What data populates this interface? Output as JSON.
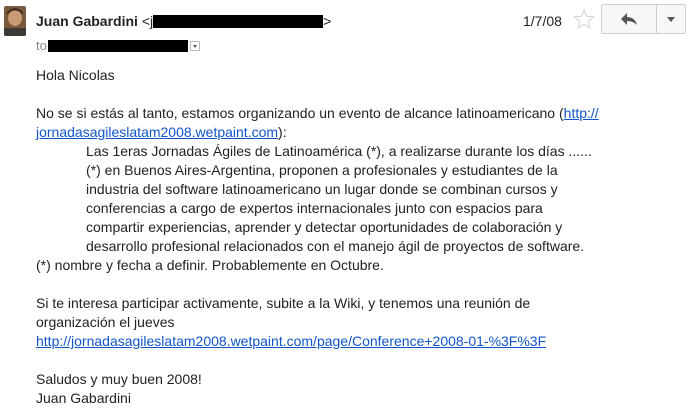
{
  "header": {
    "sender_name": "Juan Gabardini",
    "sender_email_prefix": "<j",
    "sender_email_suffix": ">",
    "date": "1/7/08",
    "to_label": "to",
    "reply_icon": "reply-arrow-icon",
    "more_icon": "dropdown-triangle-icon",
    "star_icon": "star-outline-icon"
  },
  "body": {
    "greeting": "Hola Nicolas",
    "p1_text": "No se si estás al tanto, estamos organizando un evento de alcance latinoamericano (",
    "p1_link_line1": "http://",
    "p1_link_line2": "jornadasagileslatam2008.wetpaint.com",
    "p1_text_end": "):",
    "quote": [
      "Las 1eras Jornadas Ágiles de Latinoamérica (*), a realizarse durante los días ......",
      "(*) en Buenos Aires-Argentina, proponen a profesionales y estudiantes de la",
      "industria del software latinoamericano un lugar donde se combinan cursos y",
      "conferencias a cargo de expertos internacionales junto con espacios para",
      "compartir experiencias, aprender y detectar oportunidades de colaboración y",
      "desarrollo profesional relacionados con el manejo ágil de proyectos de software."
    ],
    "footnote": "(*) nombre y fecha a definir. Probablemente en Octubre.",
    "p2_line1": "Si te interesa participar activamente, subite a la Wiki, y tenemos una reunión de",
    "p2_line2": "organización el jueves",
    "p2_link": "http://jornadasagileslatam2008.wetpaint.com/page/Conference+2008-01-%3F%3F",
    "closing": "Saludos y muy buen 2008!",
    "signature": "Juan Gabardini"
  },
  "colors": {
    "link": "#1155cc",
    "text": "#222222",
    "redaction": "#000000"
  }
}
